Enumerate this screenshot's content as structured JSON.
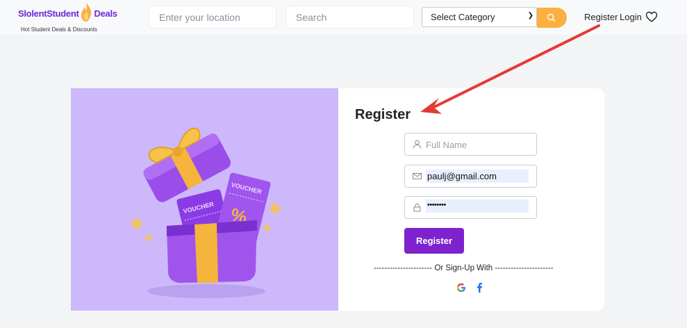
{
  "header": {
    "brand_left": "SlolentStudent",
    "brand_right": "Deals",
    "tagline": "Hot Student Deals & Discounts",
    "location_placeholder": "Enter your location",
    "search_placeholder": "Search",
    "category_selected": "Select Category",
    "register_link": "Register",
    "login_link": "Login"
  },
  "hero": {
    "voucher_text_1": "VOUCHER",
    "voucher_text_2": "VOUCHER"
  },
  "form": {
    "title": "Register",
    "full_name_placeholder": "Full Name",
    "email_value": "paulj@gmail.com",
    "password_value": "••••••••",
    "submit_label": "Register",
    "divider_text": "---------------------- Or Sign-Up With ----------------------"
  },
  "colors": {
    "brand_purple": "#6d28d9",
    "button_purple": "#7e22ce",
    "search_orange": "#fbb040",
    "hero_bg": "#cdb8fb",
    "annotation_arrow": "#e53935"
  }
}
